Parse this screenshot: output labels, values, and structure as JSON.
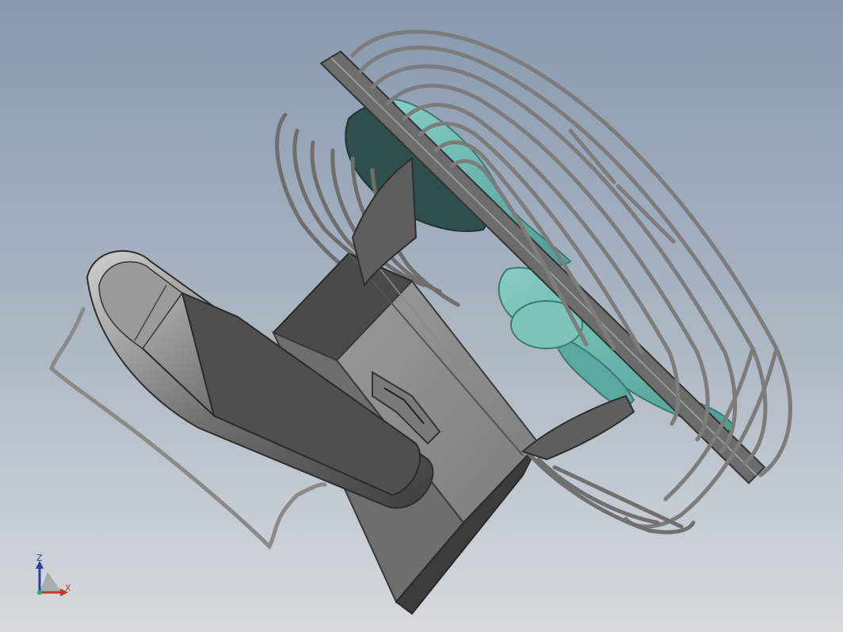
{
  "colors": {
    "background_top": "#8a9bb0",
    "background_bottom": "#d4d9df",
    "body_gray": "#8c8c8c",
    "body_dark": "#5a5a5a",
    "body_light": "#b4b4b4",
    "cage_wire": "#7a7a7a",
    "blade_teal": "#6fb8b0",
    "blade_dark": "#2f4f4d",
    "axis_x": "#c0392b",
    "axis_y": "#27ae60",
    "axis_z": "#2c3e9e"
  },
  "triad": {
    "z_label": "Z",
    "x_label": "X"
  },
  "icons": {
    "triad": "coordinate-triad-icon"
  }
}
